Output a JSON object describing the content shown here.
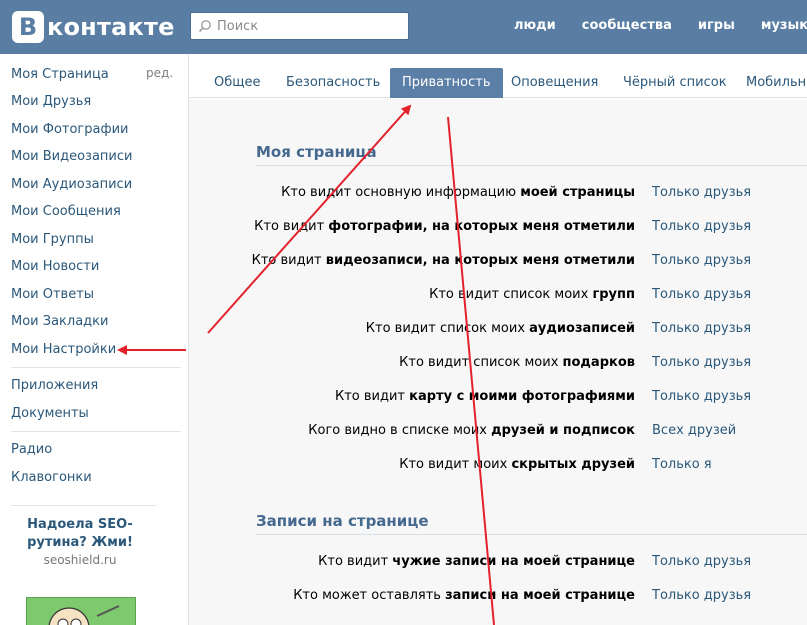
{
  "header": {
    "logo_letter": "В",
    "logo_text": "контакте",
    "search_placeholder": "Поиск",
    "nav": [
      "люди",
      "сообщества",
      "игры",
      "музыка"
    ]
  },
  "sidebar": {
    "edit_label": "ред.",
    "items": [
      "Моя Страница",
      "Мои Друзья",
      "Мои Фотографии",
      "Мои Видеозаписи",
      "Мои Аудиозаписи",
      "Мои Сообщения",
      "Мои Группы",
      "Мои Новости",
      "Мои Ответы",
      "Мои Закладки",
      "Мои Настройки"
    ],
    "apps": [
      "Приложения",
      "Документы"
    ],
    "extra": [
      "Радио",
      "Клавогонки"
    ],
    "promo": {
      "title": "Надоела SEO-рутина? Жми!",
      "site": "seoshield.ru"
    }
  },
  "tabs": [
    "Общее",
    "Безопасность",
    "Приватность",
    "Оповещения",
    "Чёрный список",
    "Мобильные"
  ],
  "active_tab": "Приватность",
  "sections": [
    {
      "title": "Моя страница",
      "rows": [
        {
          "pre": "Кто видит основную информацию ",
          "bold": "моей страницы",
          "value": "Только друзья"
        },
        {
          "pre": "Кто видит ",
          "bold": "фотографии, на которых меня отметили",
          "value": "Только друзья"
        },
        {
          "pre": "Кто видит ",
          "bold": "видеозаписи, на которых меня отметили",
          "value": "Только друзья"
        },
        {
          "pre": "Кто видит список моих ",
          "bold": "групп",
          "value": "Только друзья"
        },
        {
          "pre": "Кто видит список моих ",
          "bold": "аудиозаписей",
          "value": "Только друзья"
        },
        {
          "pre": "Кто видит список моих ",
          "bold": "подарков",
          "value": "Только друзья"
        },
        {
          "pre": "Кто видит ",
          "bold": "карту с моими фотографиями",
          "value": "Только друзья"
        },
        {
          "pre": "Кого видно в списке моих ",
          "bold": "друзей и подписок",
          "value": "Всех друзей"
        },
        {
          "pre": "Кто видит моих ",
          "bold": "скрытых друзей",
          "value": "Только я"
        }
      ]
    },
    {
      "title": "Записи на странице",
      "rows": [
        {
          "pre": "Кто видит ",
          "bold": "чужие записи на моей странице",
          "value": "Только друзья"
        },
        {
          "pre": "Кто может оставлять ",
          "bold": "записи на моей странице",
          "value": "Только друзья"
        }
      ]
    }
  ],
  "colors": {
    "header": "#597da3",
    "link": "#2b587a",
    "section_title": "#45688e",
    "active_tab": "#5b7fa6",
    "annotation_arrow": "#e3222c"
  }
}
